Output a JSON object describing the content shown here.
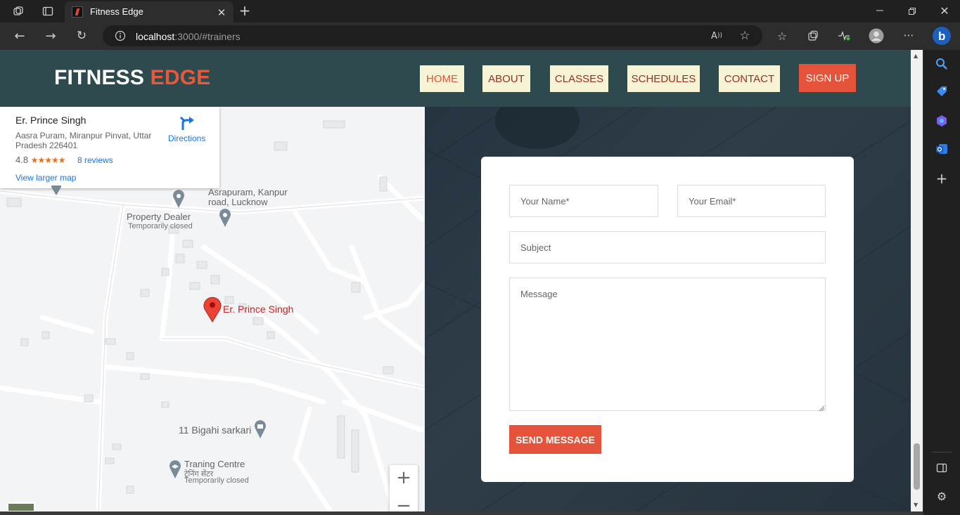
{
  "browser": {
    "tab_title": "Fitness Edge",
    "url_host": "localhost",
    "url_rest": ":3000/#trainers"
  },
  "site": {
    "logo_part1": "FITNESS ",
    "logo_part2": "EDGE",
    "nav": [
      {
        "label": "HOME",
        "active": true
      },
      {
        "label": "ABOUT",
        "active": false
      },
      {
        "label": "CLASSES",
        "active": false
      },
      {
        "label": "SCHEDULES",
        "active": false
      },
      {
        "label": "CONTACT",
        "active": false
      }
    ],
    "signup_label": "SIGN UP"
  },
  "map": {
    "card": {
      "title": "Er. Prince Singh",
      "address": "Aasra Puram, Miranpur Pinvat, Uttar Pradesh 226401",
      "rating": "4.8",
      "stars": "★★★★★",
      "reviews": "8 reviews",
      "view_larger": "View larger map",
      "directions": "Directions"
    },
    "labels": {
      "asrapuram": "Asrapuram, Kanpur road, Lucknow",
      "property_dealer": "Property Dealer",
      "property_status": "Temporarily closed",
      "pin_name": "Er. Prince Singh",
      "bigahi": "11 Bigahi sarkari",
      "training": "Traning Centre",
      "training_hindi": "ट्रेनिंग सेंटर",
      "training_status": "Temporarily closed"
    },
    "zoom_in": "+",
    "zoom_out": "−"
  },
  "contact_form": {
    "name_placeholder": "Your Name*",
    "email_placeholder": "Your Email*",
    "subject_placeholder": "Subject",
    "message_placeholder": "Message",
    "send_label": "SEND MESSAGE"
  },
  "colors": {
    "accent": "#e4533a",
    "header_bg": "#2e4a4f",
    "nav_bg": "#f7f3d5",
    "nav_text": "#9b2c1f"
  }
}
